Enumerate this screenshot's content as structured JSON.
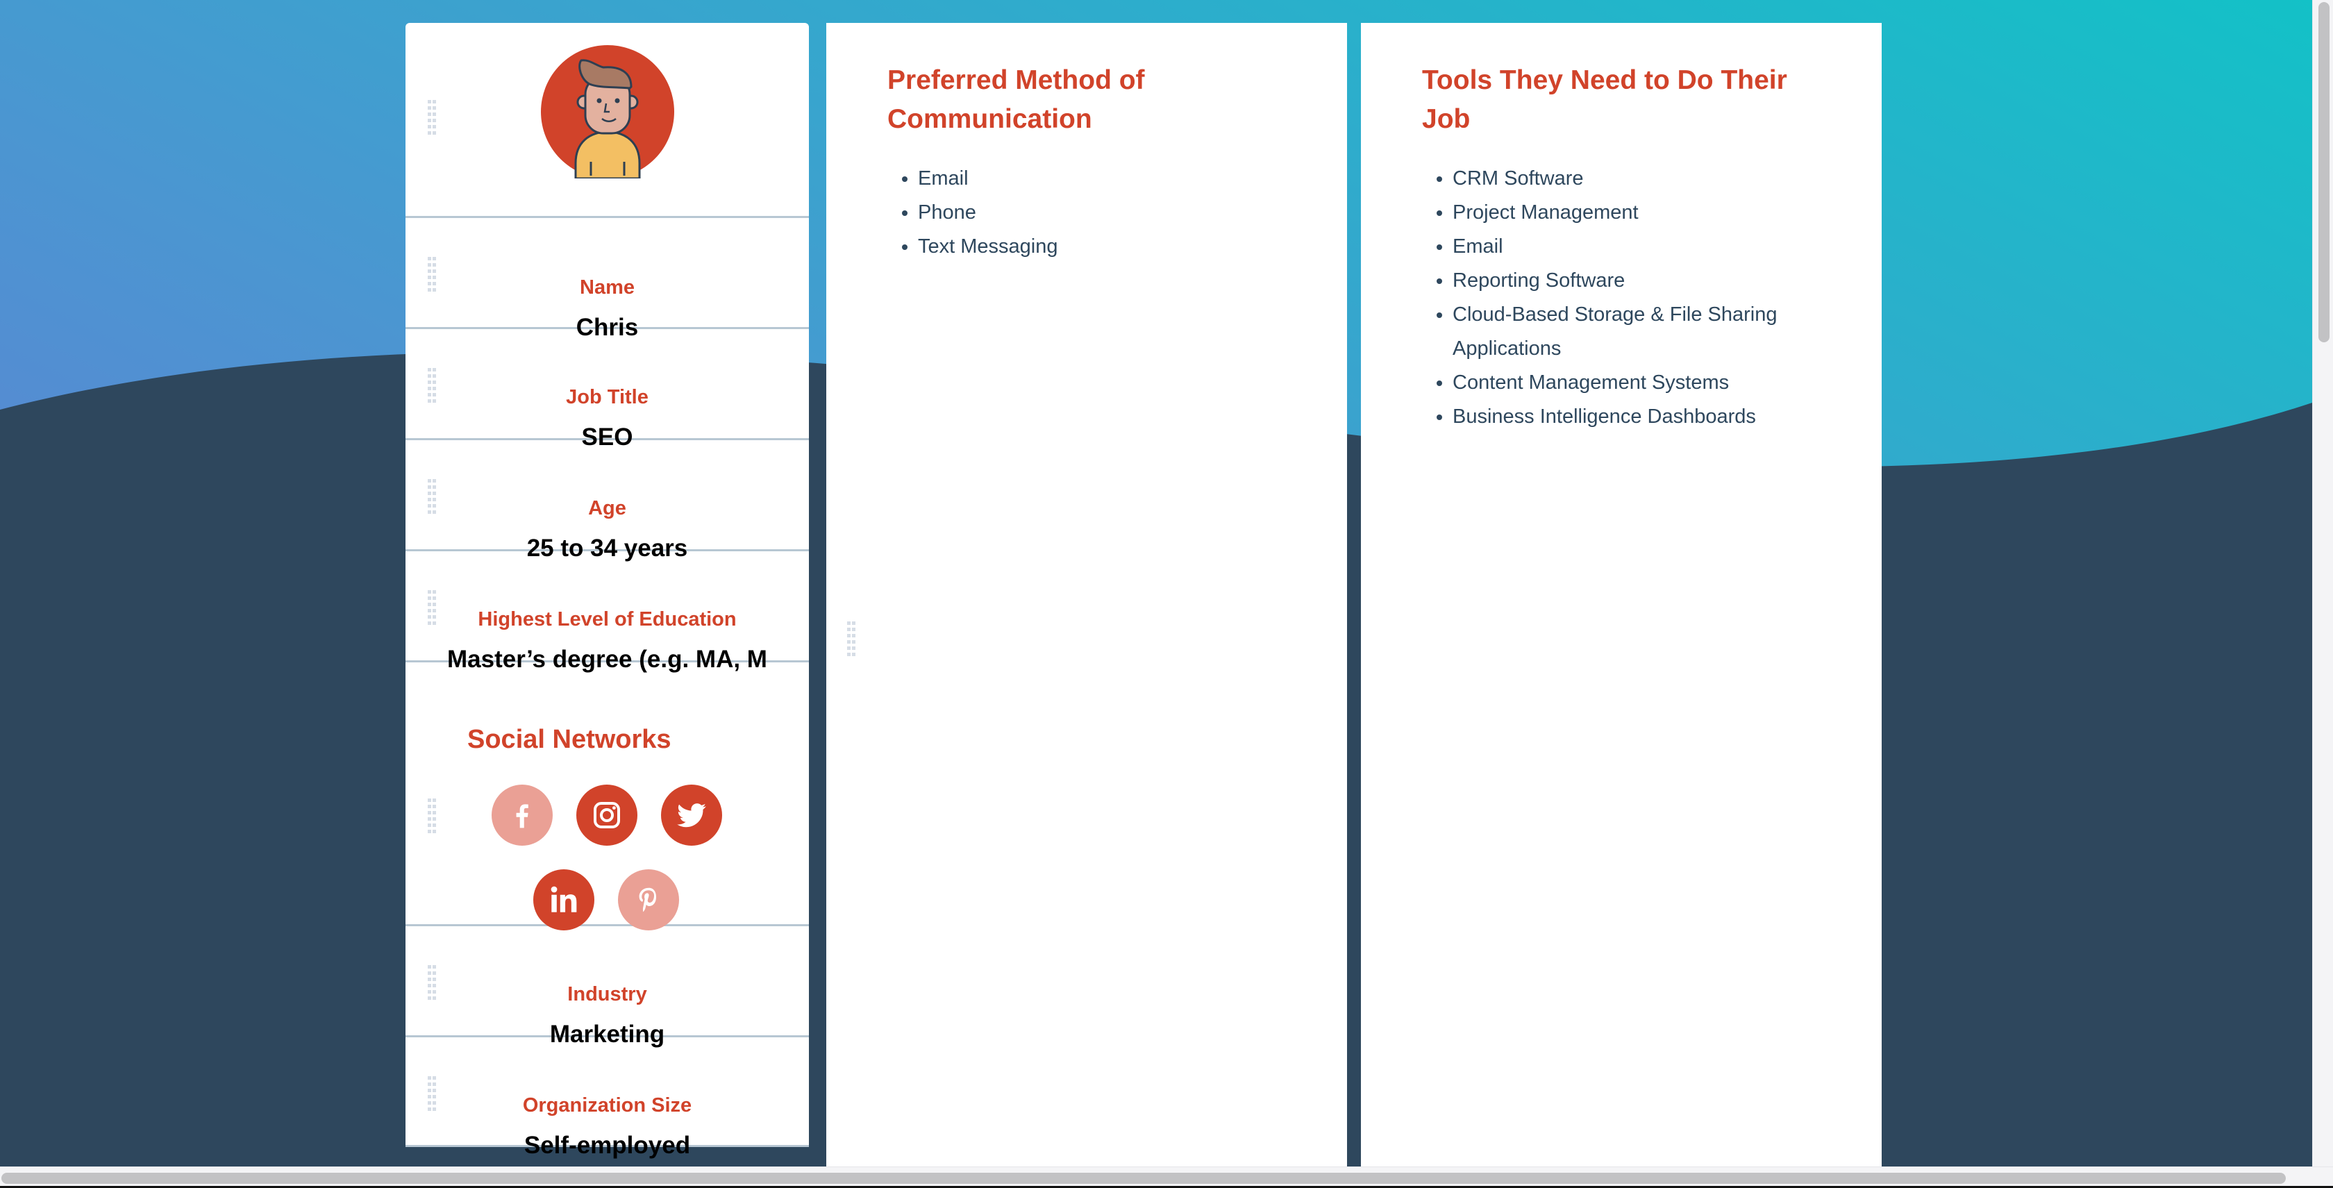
{
  "colors": {
    "accent": "#d1432a",
    "accent_faded": "#eaa095",
    "text_dark": "#2e475d",
    "value_text": "#000000",
    "background_dark": "#2e475d",
    "gradient_start": "#6c74d6",
    "gradient_mid": "#4b96d1",
    "gradient_end": "#13c1c7",
    "divider": "#b7c7d3"
  },
  "persona": {
    "avatar": "avatar-illustration",
    "fields": [
      {
        "label": "Name",
        "value": "Chris"
      },
      {
        "label": "Job Title",
        "value": "SEO"
      },
      {
        "label": "Age",
        "value": "25 to 34 years"
      },
      {
        "label": "Highest Level of Education",
        "value": "Master’s degree (e.g. MA, MS, MEd)"
      }
    ],
    "social": {
      "title": "Social Networks",
      "networks": [
        {
          "name": "Facebook",
          "icon": "facebook-icon",
          "selected": false
        },
        {
          "name": "Instagram",
          "icon": "instagram-icon",
          "selected": true
        },
        {
          "name": "Twitter",
          "icon": "twitter-icon",
          "selected": true
        },
        {
          "name": "LinkedIn",
          "icon": "linkedin-icon",
          "selected": true
        },
        {
          "name": "Pinterest",
          "icon": "pinterest-icon",
          "selected": false
        }
      ]
    },
    "fields_after": [
      {
        "label": "Industry",
        "value": "Marketing"
      },
      {
        "label": "Organization Size",
        "value": "Self-employed"
      }
    ]
  },
  "communication": {
    "title": "Preferred Method of Communication",
    "items": [
      "Email",
      "Phone",
      "Text Messaging"
    ]
  },
  "tools": {
    "title": "Tools They Need to Do Their Job",
    "items": [
      "CRM Software",
      "Project Management",
      "Email",
      "Reporting Software",
      "Cloud-Based Storage & File Sharing Applications",
      "Content Management Systems",
      "Business Intelligence Dashboards"
    ]
  }
}
